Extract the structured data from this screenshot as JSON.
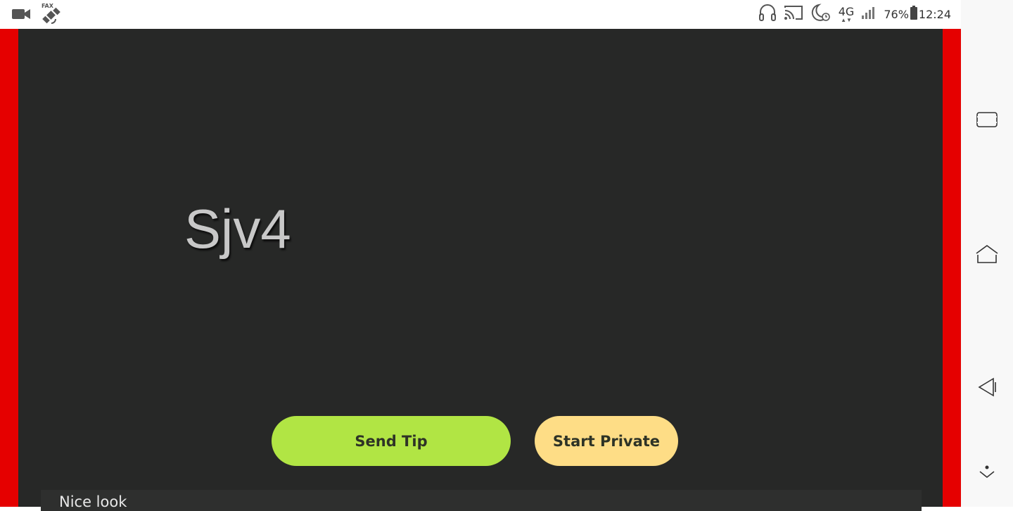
{
  "status_bar": {
    "icons_left": [
      "video-camera-icon",
      "satellite-fax-icon"
    ],
    "fax_label": "FAX",
    "icons_right": [
      "headphones-icon",
      "cast-icon",
      "moon-alarm-icon",
      "network-4g-icon",
      "signal-icon",
      "battery-icon"
    ],
    "network": "4G",
    "battery": "76%",
    "time": "12:24"
  },
  "stream": {
    "watermark": "Sjv4",
    "frame_color": "#e50000",
    "background_color": "#272827"
  },
  "actions": {
    "send_tip_label": "Send Tip",
    "send_tip_color": "#b1e544",
    "start_private_label": "Start Private",
    "start_private_color": "#fedd86"
  },
  "chat": {
    "message": "Nice look"
  },
  "nav_bar": {
    "buttons": [
      "recent-apps-icon",
      "home-icon",
      "back-icon",
      "hide-nav-icon"
    ]
  }
}
